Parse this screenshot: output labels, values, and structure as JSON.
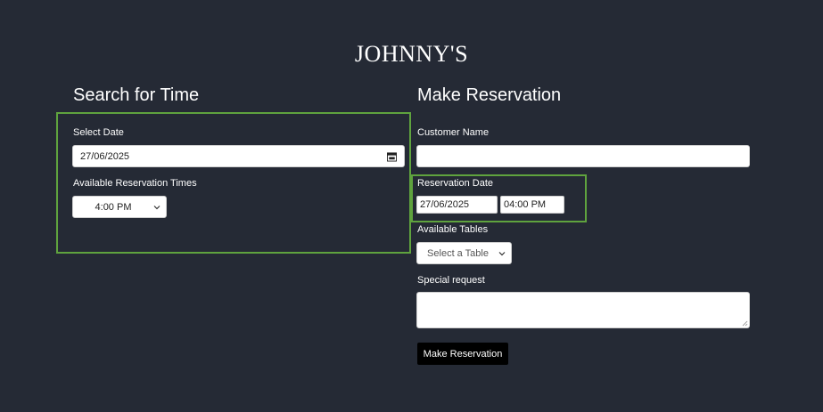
{
  "brand": {
    "name": "JOHNNY'S"
  },
  "search": {
    "title": "Search for Time",
    "date_label": "Select Date",
    "date_value": "27/06/2025",
    "times_label": "Available Reservation Times",
    "time_selected": "4:00 PM"
  },
  "reservation": {
    "title": "Make Reservation",
    "customer_label": "Customer Name",
    "customer_value": "",
    "date_label": "Reservation Date",
    "date_value": "27/06/2025",
    "time_value": "04:00 PM",
    "tables_label": "Available Tables",
    "table_selected": "Select a Table",
    "request_label": "Special request",
    "request_value": "",
    "submit_label": "Make Reservation"
  },
  "colors": {
    "background": "#252a35",
    "highlight": "#5fa33e",
    "button": "#000000"
  }
}
